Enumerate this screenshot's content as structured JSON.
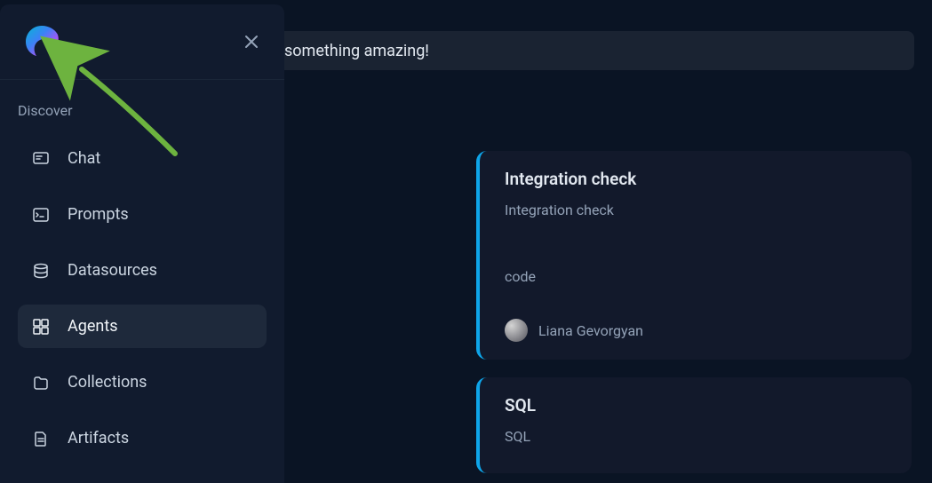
{
  "banner": {
    "text": "something amazing!"
  },
  "sidebar": {
    "section_label": "Discover",
    "items": [
      {
        "label": "Chat",
        "icon": "chat-icon",
        "active": false
      },
      {
        "label": "Prompts",
        "icon": "prompts-icon",
        "active": false
      },
      {
        "label": "Datasources",
        "icon": "datasources-icon",
        "active": false
      },
      {
        "label": "Agents",
        "icon": "agents-icon",
        "active": true
      },
      {
        "label": "Collections",
        "icon": "collections-icon",
        "active": false
      },
      {
        "label": "Artifacts",
        "icon": "artifacts-icon",
        "active": false
      }
    ]
  },
  "cards": [
    {
      "title": "Integration check",
      "subtitle": "Integration check",
      "tag": "code",
      "author": "Liana Gevorgyan"
    },
    {
      "title": "SQL",
      "subtitle": "SQL"
    }
  ],
  "colors": {
    "accent": "#0ea5e9",
    "arrow": "#6db33f"
  }
}
